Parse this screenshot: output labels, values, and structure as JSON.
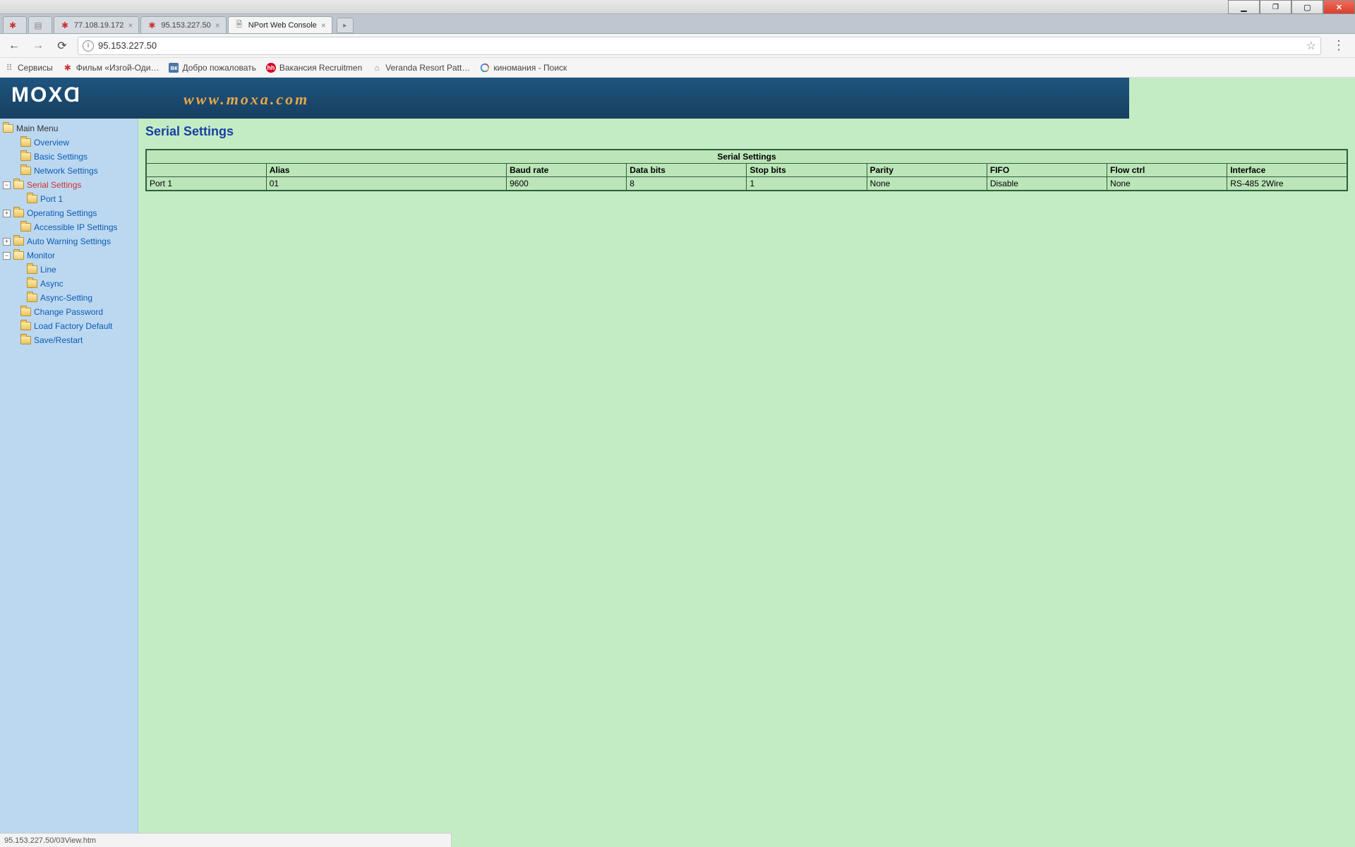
{
  "window_controls": {
    "min": "",
    "restore": "",
    "max": "",
    "close": ""
  },
  "tabs": [
    {
      "title": "",
      "icon": "red",
      "closable": false
    },
    {
      "title": "",
      "icon": "pg",
      "closable": false
    },
    {
      "title": "77.108.19.172",
      "icon": "red",
      "closable": true
    },
    {
      "title": "95.153.227.50",
      "icon": "red",
      "closable": true
    },
    {
      "title": "NPort Web Console",
      "icon": "doc",
      "closable": true,
      "active": true
    }
  ],
  "addressbar": {
    "url": "95.153.227.50"
  },
  "bookmarks": [
    {
      "label": "Сервисы",
      "icon": "ico-grid"
    },
    {
      "label": "Фильм «Изгой-Оди…",
      "icon": "ico-red"
    },
    {
      "label": "Добро пожаловать",
      "icon": "ico-vk",
      "iconText": "вк"
    },
    {
      "label": "Вакансия Recruitmen",
      "icon": "ico-hh",
      "iconText": "hh"
    },
    {
      "label": "Veranda Resort Patt…",
      "icon": "ico-v"
    },
    {
      "label": "киномания - Поиск",
      "icon": "ico-g"
    }
  ],
  "branding": {
    "logo": "MOXⱭ",
    "url": "www.moxa.com"
  },
  "sidebar": {
    "root": "Main Menu",
    "items": [
      {
        "label": "Overview"
      },
      {
        "label": "Basic Settings"
      },
      {
        "label": "Network Settings"
      },
      {
        "label": "Serial Settings",
        "active": true,
        "expanded": true,
        "children": [
          {
            "label": "Port 1"
          }
        ]
      },
      {
        "label": "Operating Settings",
        "expandable": true
      },
      {
        "label": "Accessible IP Settings"
      },
      {
        "label": "Auto Warning Settings",
        "expandable": true
      },
      {
        "label": "Monitor",
        "expanded": true,
        "children": [
          {
            "label": "Line"
          },
          {
            "label": "Async"
          },
          {
            "label": "Async-Setting"
          }
        ]
      },
      {
        "label": "Change Password"
      },
      {
        "label": "Load Factory Default"
      },
      {
        "label": "Save/Restart"
      }
    ]
  },
  "page": {
    "title": "Serial Settings",
    "table": {
      "caption": "Serial Settings",
      "headers": [
        "",
        "Alias",
        "Baud rate",
        "Data bits",
        "Stop bits",
        "Parity",
        "FIFO",
        "Flow ctrl",
        "Interface"
      ],
      "rows": [
        [
          "Port 1",
          "01",
          "9600",
          "8",
          "1",
          "None",
          "Disable",
          "None",
          "RS-485 2Wire"
        ]
      ]
    }
  },
  "status": "95.153.227.50/03View.htm"
}
